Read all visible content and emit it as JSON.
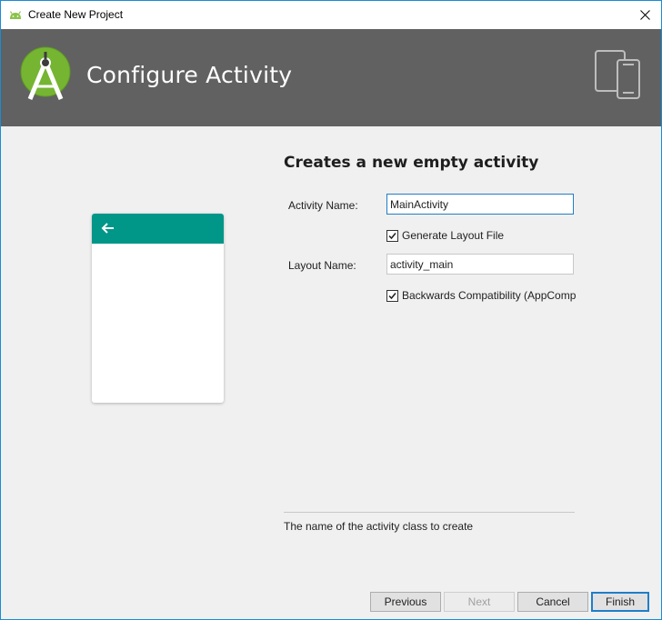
{
  "window": {
    "title": "Create New Project"
  },
  "header": {
    "heading": "Configure Activity",
    "logo_icon": "android-studio-logo-icon",
    "device_icon": "phone-tablet-icon",
    "background_color": "#616161"
  },
  "preview": {
    "appbar_color": "#009688",
    "back_icon": "arrow-back-icon"
  },
  "form": {
    "title": "Creates a new empty activity",
    "activity_name_label": "Activity Name:",
    "activity_name_value": "MainActivity",
    "generate_layout_label": "Generate Layout File",
    "generate_layout_checked": true,
    "layout_name_label": "Layout Name:",
    "layout_name_value": "activity_main",
    "backwards_compat_label": "Backwards Compatibility (AppCompat)",
    "backwards_compat_checked": true
  },
  "hint": "The name of the activity class to create",
  "buttons": {
    "previous": "Previous",
    "next": "Next",
    "cancel": "Cancel",
    "finish": "Finish"
  }
}
